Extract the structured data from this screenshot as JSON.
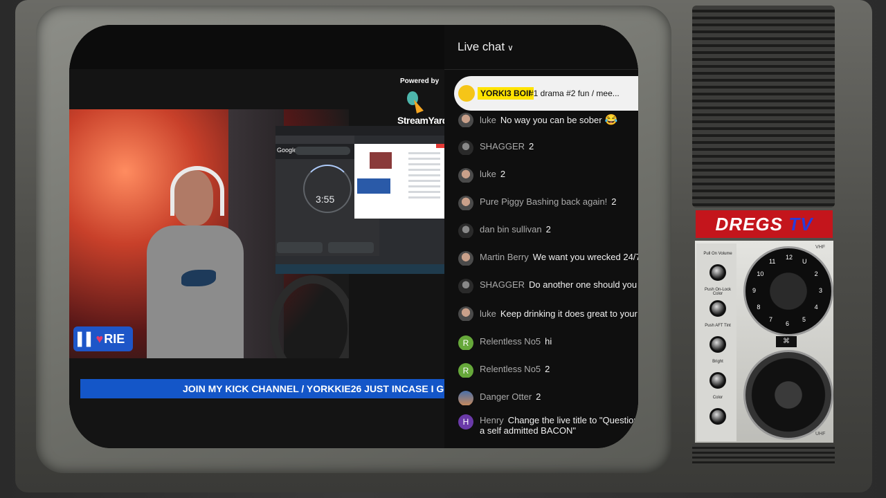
{
  "stream": {
    "powered_by": "Powered by",
    "streamyard": "StreamYard",
    "badge_left": "▌▌",
    "badge_right": "RIE",
    "timer": "3:55",
    "google": "Google",
    "ticker": "JOIN MY KICK CHANNEL / YORKKIE26 JUST INCASE I GET BANNED AGA"
  },
  "chat": {
    "title": "Live chat",
    "pinned": {
      "name": "YORKI3 BOII",
      "message": "#1 drama #2 fun / mee..."
    },
    "messages": [
      {
        "name": "luke",
        "text": "No way you can be sober",
        "emoji": "😂",
        "avatar": "photo"
      },
      {
        "name": "SHAGGER",
        "text": "2",
        "avatar": "dark"
      },
      {
        "name": "luke",
        "text": "2",
        "avatar": "photo"
      },
      {
        "name": "Pure Piggy Bashing back again!",
        "text": "2",
        "avatar": "photo"
      },
      {
        "name": "dan bin sullivan",
        "text": "2",
        "avatar": "dark"
      },
      {
        "name": "Martin Berry",
        "text": "We want you wrecked 24/7 mate.",
        "avatar": "photo"
      },
      {
        "name": "SHAGGER",
        "text": "Do another one should you top yoursel",
        "avatar": "dark"
      },
      {
        "name": "luke",
        "text": "Keep drinking it does great to your liver",
        "emoji": "👍",
        "avatar": "photo"
      },
      {
        "name": "Relentless No5",
        "text": "hi",
        "avatar": "green",
        "initial": "R"
      },
      {
        "name": "Relentless No5",
        "text": "2",
        "avatar": "green",
        "initial": "R"
      },
      {
        "name": "Danger Otter",
        "text": "2",
        "avatar": "sky"
      },
      {
        "name": "Henry",
        "text": "Change the live title to \"Question Time v",
        "text2": "a self admitted BACON\"",
        "avatar": "purple",
        "initial": "H"
      }
    ]
  },
  "tv": {
    "brand_a": "DREGS",
    "brand_b": "TV",
    "labels": [
      "Pull On Volume",
      "Push On-Lock Color",
      "Push AFT Tint",
      "Bright",
      "Color"
    ],
    "vhf": "VHF",
    "uhf": "UHF",
    "dial_numbers": [
      "12",
      "U",
      "2",
      "3",
      "4",
      "5",
      "6",
      "7",
      "8",
      "9",
      "10",
      "11"
    ]
  },
  "colors": {
    "ticker": "#1456c8",
    "brand_red": "#c4151c",
    "brand_blue": "#2a3bd8",
    "pinned_tag": "#ffe300"
  }
}
